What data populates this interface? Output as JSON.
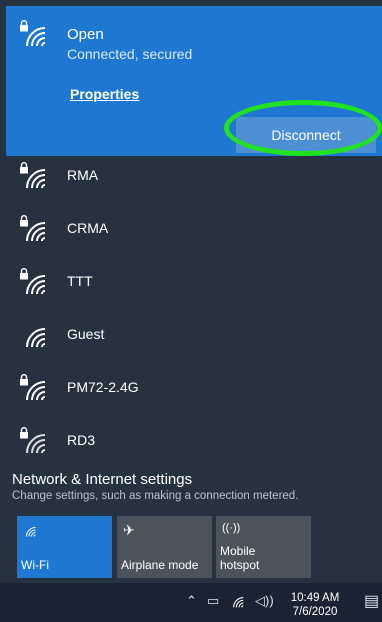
{
  "connected_network": {
    "name": "Open",
    "status": "Connected, secured",
    "properties_label": "Properties",
    "disconnect_label": "Disconnect"
  },
  "networks": [
    {
      "name": "RMA",
      "secured": true
    },
    {
      "name": "CRMA",
      "secured": true
    },
    {
      "name": "TTT",
      "secured": true
    },
    {
      "name": "Guest",
      "secured": false
    },
    {
      "name": "PM72-2.4G",
      "secured": true
    },
    {
      "name": "RD3",
      "secured": true
    }
  ],
  "settings": {
    "title": "Network & Internet settings",
    "subtitle": "Change settings, such as making a connection metered."
  },
  "quick_actions": [
    {
      "label": "Wi-Fi",
      "icon": "wifi-icon",
      "active": true
    },
    {
      "label": "Airplane mode",
      "icon": "airplane-icon",
      "active": false
    },
    {
      "label": "Mobile\nhotspot",
      "icon": "hotspot-icon",
      "active": false
    }
  ],
  "taskbar": {
    "time": "10:49 AM",
    "date": "7/6/2020",
    "icons": [
      "chevron-up-icon",
      "battery-icon",
      "wifi-icon",
      "volume-icon",
      "notification-icon"
    ]
  },
  "colors": {
    "accent": "#1e78d2",
    "flyout_bg": "#26323f",
    "highlight": "#22e11f"
  }
}
